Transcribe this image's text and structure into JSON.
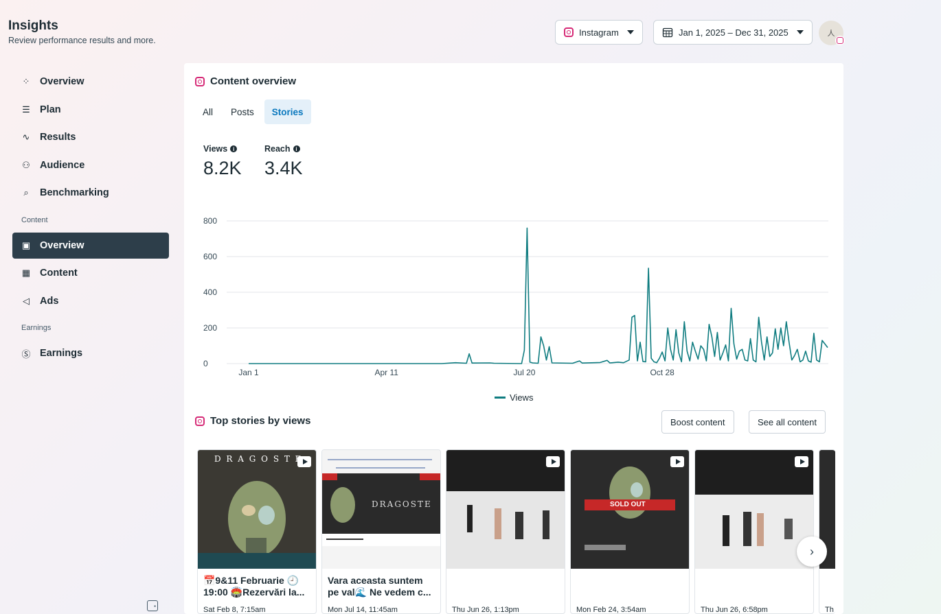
{
  "header": {
    "title": "Insights",
    "subtitle": "Review performance results and more.",
    "platform_selector": "Instagram",
    "date_range": "Jan 1, 2025 – Dec 31, 2025",
    "avatar_text": "⼈"
  },
  "sidebar": {
    "items": [
      {
        "label": "Overview",
        "icon": "network-icon"
      },
      {
        "label": "Plan",
        "icon": "list-icon"
      },
      {
        "label": "Results",
        "icon": "trend-icon"
      },
      {
        "label": "Audience",
        "icon": "people-icon"
      },
      {
        "label": "Benchmarking",
        "icon": "benchmark-icon"
      }
    ],
    "content_section_label": "Content",
    "content_items": [
      {
        "label": "Overview",
        "icon": "content-overview-icon",
        "active": true
      },
      {
        "label": "Content",
        "icon": "grid-icon"
      },
      {
        "label": "Ads",
        "icon": "megaphone-icon"
      }
    ],
    "earnings_section_label": "Earnings",
    "earnings_items": [
      {
        "label": "Earnings",
        "icon": "dollar-icon"
      }
    ]
  },
  "content_overview": {
    "title": "Content overview",
    "tabs": [
      "All",
      "Posts",
      "Stories"
    ],
    "active_tab": "Stories",
    "metrics": [
      {
        "label": "Views",
        "value": "8.2K"
      },
      {
        "label": "Reach",
        "value": "3.4K"
      }
    ]
  },
  "chart_data": {
    "type": "line",
    "title": "",
    "xlabel": "",
    "ylabel": "",
    "ylim": [
      0,
      800
    ],
    "yticks": [
      "800",
      "600",
      "400",
      "200",
      "0"
    ],
    "xticks": [
      "Jan 1",
      "Apr 11",
      "Jul 20",
      "Oct 28"
    ],
    "grid": true,
    "legend": "bottom",
    "series": [
      {
        "name": "Views",
        "color": "#0f7c80",
        "points": [
          [
            0,
            0
          ],
          [
            140,
            0
          ],
          [
            150,
            5
          ],
          [
            158,
            2
          ],
          [
            160,
            55
          ],
          [
            162,
            3
          ],
          [
            175,
            4
          ],
          [
            178,
            2
          ],
          [
            198,
            0
          ],
          [
            200,
            75
          ],
          [
            202,
            760
          ],
          [
            204,
            8
          ],
          [
            206,
            4
          ],
          [
            210,
            2
          ],
          [
            212,
            150
          ],
          [
            214,
            100
          ],
          [
            216,
            20
          ],
          [
            218,
            95
          ],
          [
            220,
            4
          ],
          [
            235,
            2
          ],
          [
            240,
            15
          ],
          [
            242,
            3
          ],
          [
            255,
            6
          ],
          [
            260,
            18
          ],
          [
            262,
            4
          ],
          [
            268,
            8
          ],
          [
            272,
            5
          ],
          [
            276,
            20
          ],
          [
            278,
            260
          ],
          [
            280,
            270
          ],
          [
            282,
            15
          ],
          [
            284,
            120
          ],
          [
            286,
            12
          ],
          [
            288,
            10
          ],
          [
            290,
            535
          ],
          [
            292,
            30
          ],
          [
            294,
            10
          ],
          [
            296,
            5
          ],
          [
            298,
            30
          ],
          [
            300,
            65
          ],
          [
            302,
            15
          ],
          [
            304,
            200
          ],
          [
            306,
            80
          ],
          [
            308,
            20
          ],
          [
            310,
            190
          ],
          [
            312,
            60
          ],
          [
            314,
            10
          ],
          [
            316,
            235
          ],
          [
            318,
            70
          ],
          [
            320,
            15
          ],
          [
            322,
            120
          ],
          [
            324,
            70
          ],
          [
            326,
            25
          ],
          [
            328,
            100
          ],
          [
            330,
            80
          ],
          [
            332,
            15
          ],
          [
            334,
            220
          ],
          [
            336,
            150
          ],
          [
            338,
            40
          ],
          [
            340,
            175
          ],
          [
            342,
            20
          ],
          [
            344,
            60
          ],
          [
            346,
            105
          ],
          [
            348,
            15
          ],
          [
            350,
            310
          ],
          [
            352,
            110
          ],
          [
            354,
            25
          ],
          [
            356,
            70
          ],
          [
            358,
            80
          ],
          [
            360,
            20
          ],
          [
            362,
            15
          ],
          [
            364,
            140
          ],
          [
            366,
            20
          ],
          [
            368,
            10
          ],
          [
            370,
            260
          ],
          [
            372,
            120
          ],
          [
            374,
            20
          ],
          [
            376,
            150
          ],
          [
            378,
            40
          ],
          [
            380,
            60
          ],
          [
            382,
            195
          ],
          [
            384,
            80
          ],
          [
            386,
            200
          ],
          [
            388,
            100
          ],
          [
            390,
            235
          ],
          [
            392,
            120
          ],
          [
            394,
            20
          ],
          [
            396,
            45
          ],
          [
            398,
            80
          ],
          [
            400,
            10
          ],
          [
            402,
            20
          ],
          [
            404,
            70
          ],
          [
            406,
            15
          ],
          [
            408,
            8
          ],
          [
            410,
            170
          ],
          [
            412,
            20
          ],
          [
            414,
            10
          ],
          [
            416,
            130
          ],
          [
            418,
            110
          ],
          [
            420,
            90
          ]
        ]
      }
    ]
  },
  "top_stories": {
    "title": "Top stories by views",
    "boost_button": "Boost content",
    "see_all_button": "See all content",
    "cards": [
      {
        "caption": "📅9&11 Februarie 🕘 19:00 🏟️Rezervări la...",
        "date": "Sat Feb 8, 7:15am",
        "thumb_text": "D R A G O S T E"
      },
      {
        "caption": "Vara aceasta suntem pe val🌊 Ne vedem c...",
        "date": "Mon Jul 14, 11:45am",
        "thumb_text": "DRAGOSTE"
      },
      {
        "caption": "",
        "date": "Thu Jun 26, 1:13pm",
        "thumb_text": ""
      },
      {
        "caption": "",
        "date": "Mon Feb 24, 3:54am",
        "thumb_text": "SOLD OUT"
      },
      {
        "caption": "",
        "date": "Thu Jun 26, 6:58pm",
        "thumb_text": ""
      },
      {
        "caption": "",
        "date": "Th",
        "thumb_text": ""
      }
    ]
  }
}
